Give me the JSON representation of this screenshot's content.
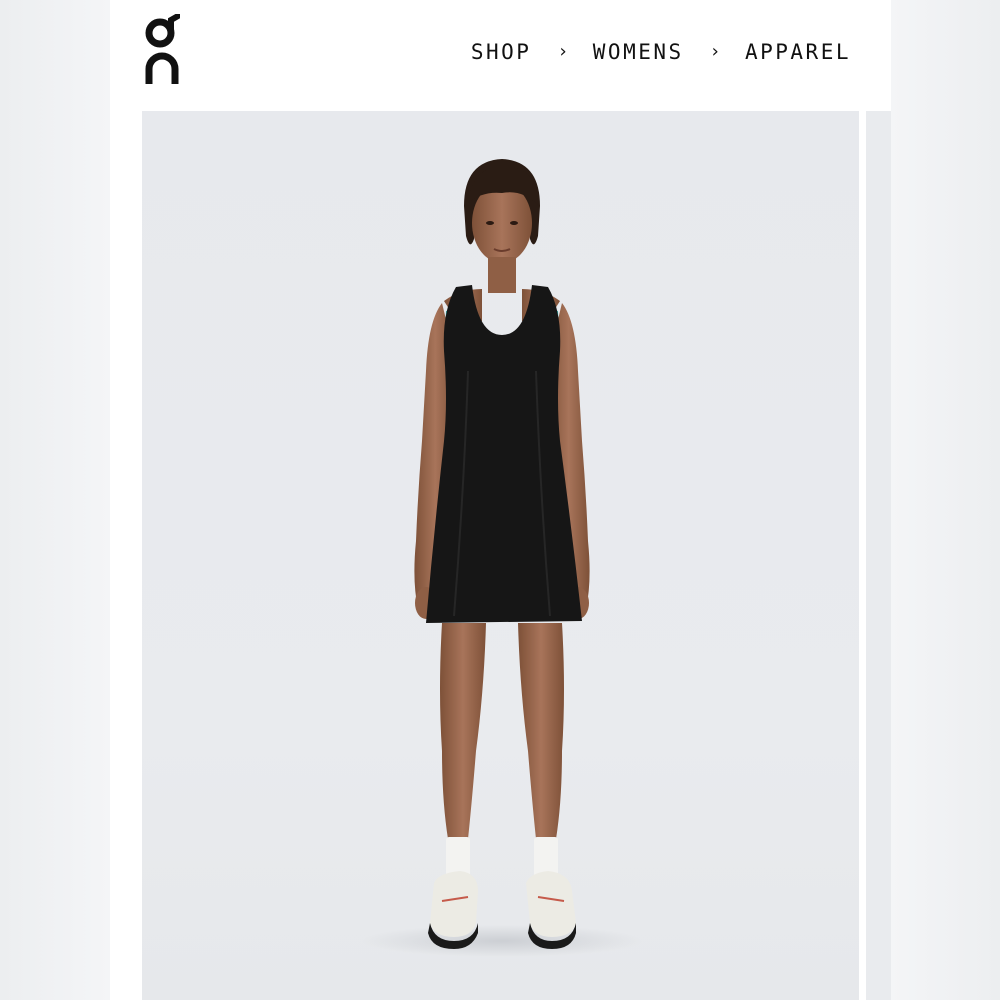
{
  "header": {
    "logo_alt": "On",
    "breadcrumb": [
      {
        "label": "SHOP"
      },
      {
        "label": "WOMENS"
      },
      {
        "label": "APPAREL"
      }
    ],
    "separator": "›"
  },
  "hero": {
    "subject": "black sleeveless dress with white sneakers",
    "background": "#e8eaed",
    "dress_color": "#161616",
    "skin_color": "#9c6b4f",
    "accent_trim": "#3fb9b3"
  }
}
